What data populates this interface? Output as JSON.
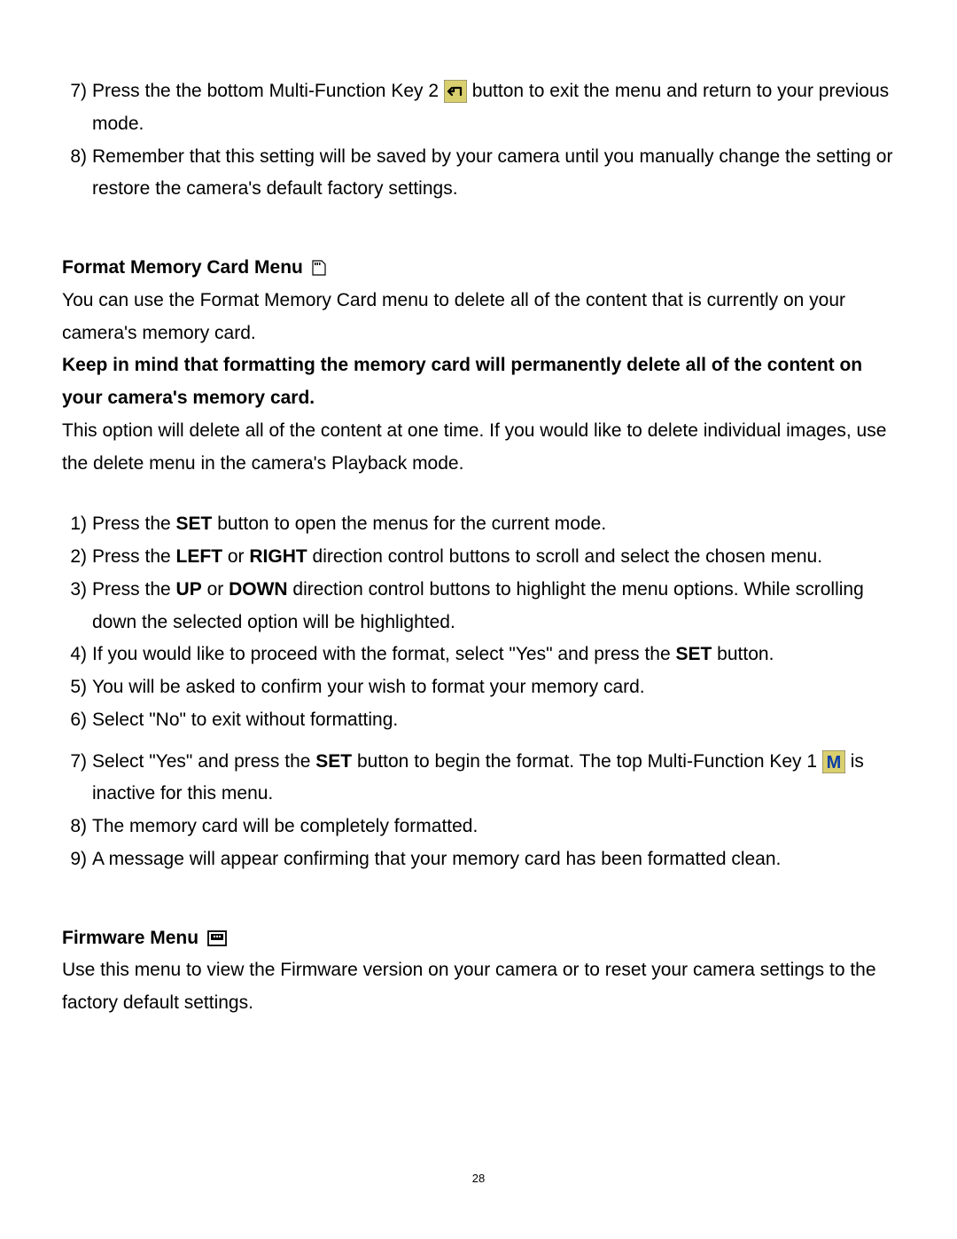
{
  "topList": {
    "item7": {
      "num": "7)",
      "part_a": "Press the the bottom Multi-Function Key 2 ",
      "part_b": " button to exit the menu and return to your previous mode."
    },
    "item8": {
      "num": "8)",
      "text": "Remember that this setting will be saved by your camera until you manually change the setting or restore the camera's default factory settings."
    }
  },
  "formatHeading": "Format Memory Card Menu",
  "formatIntro": "You can use the Format Memory Card menu to delete all of the content that is currently on your camera's memory card.",
  "formatWarning": "Keep in mind that formatting the memory card will permanently delete all of the content on your camera's memory card.",
  "formatNote": "This option will delete all of the content at one time. If you would like to delete individual images, use the delete menu in the camera's Playback mode.",
  "formatList": {
    "item1": {
      "num": "1)",
      "a": "Press the ",
      "b": "SET",
      "c": " button to open the menus for the current mode."
    },
    "item2": {
      "num": "2)",
      "a": "Press the ",
      "b": "LEFT",
      "c": " or ",
      "d": "RIGHT",
      "e": " direction control buttons to scroll and select the chosen menu."
    },
    "item3": {
      "num": "3)",
      "a": "Press the ",
      "b": "UP",
      "c": " or ",
      "d": "DOWN",
      "e": " direction control buttons to highlight the menu options. While scrolling down the selected option will be highlighted."
    },
    "item4": {
      "num": "4)",
      "a": "If you would like to proceed with the format, select \"Yes\" and press the ",
      "b": "SET",
      "c": " button."
    },
    "item5": {
      "num": "5)",
      "text": "You will be asked to confirm your wish to format your memory card."
    },
    "item6": {
      "num": "6)",
      "text": "Select \"No\" to exit without formatting."
    },
    "item7": {
      "num": "7)",
      "a": "Select \"Yes\" and press the ",
      "b": "SET",
      "c": " button to begin the format. The top Multi-Function Key 1 ",
      "d": " is inactive for this menu."
    },
    "item8": {
      "num": "8)",
      "text": "The memory card will be completely formatted."
    },
    "item9": {
      "num": "9)",
      "text": "A message will appear confirming that your memory card has been formatted clean."
    }
  },
  "firmwareHeading": "Firmware Menu",
  "firmwareIntro": "Use this menu to view the Firmware version on your camera or to reset your camera settings to the factory default settings.",
  "pageNumber": "28"
}
